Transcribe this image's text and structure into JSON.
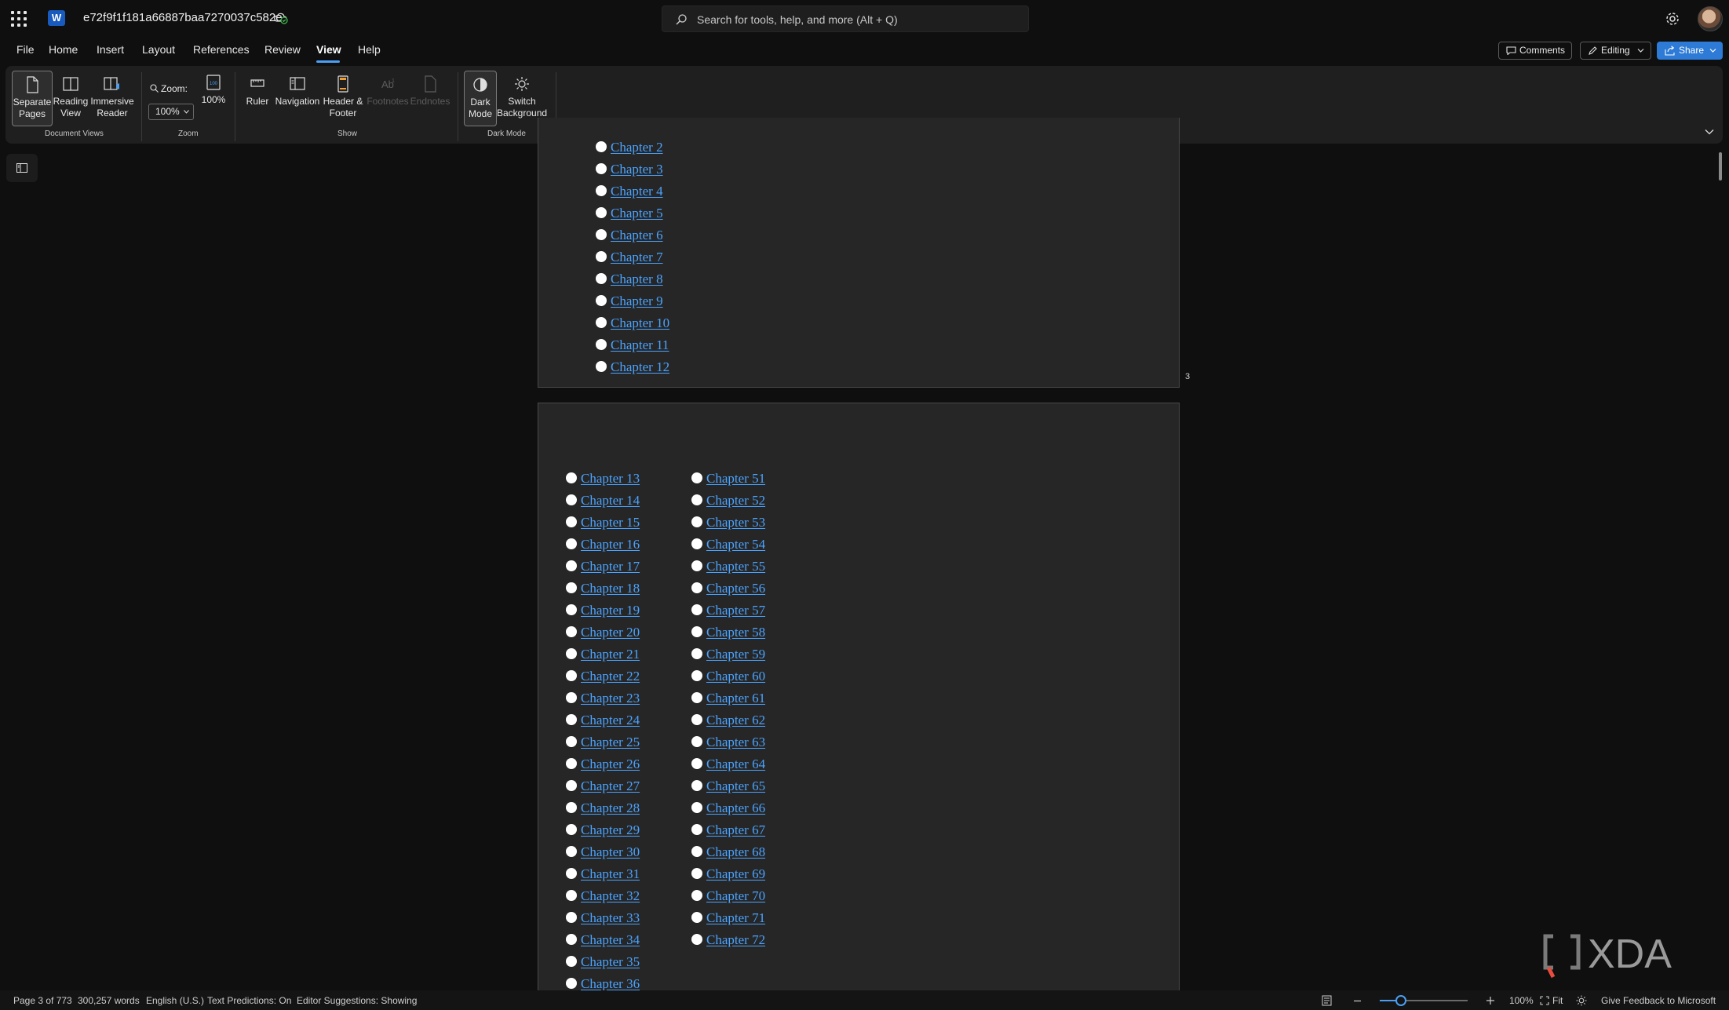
{
  "app": {
    "doc_title": "e72f9f1f181a66887baa7270037c582e",
    "search_placeholder": "Search for tools, help, and more (Alt + Q)"
  },
  "menu": {
    "items": [
      "File",
      "Home",
      "Insert",
      "Layout",
      "References",
      "Review",
      "View",
      "Help"
    ],
    "active": "View",
    "comments_label": "Comments",
    "editing_label": "Editing",
    "share_label": "Share"
  },
  "ribbon": {
    "document_views": {
      "separate_pages": "Separate\nPages",
      "reading_view": "Reading\nView",
      "immersive_reader": "Immersive\nReader",
      "group_label": "Document Views"
    },
    "zoom": {
      "zoom_label": "Zoom:",
      "zoom_value": "100%",
      "hundred_percent": "100%",
      "group_label": "Zoom"
    },
    "show": {
      "ruler": "Ruler",
      "navigation": "Navigation",
      "header_footer": "Header &\nFooter",
      "footnotes": "Footnotes",
      "endnotes": "Endnotes",
      "group_label": "Show"
    },
    "dark_mode": {
      "dark_mode": "Dark\nMode",
      "switch_background": "Switch\nBackground",
      "group_label": "Dark Mode"
    }
  },
  "document": {
    "page1_chapters": [
      "Chapter 2",
      "Chapter 3",
      "Chapter 4",
      "Chapter 5",
      "Chapter 6",
      "Chapter 7",
      "Chapter 8",
      "Chapter 9",
      "Chapter 10",
      "Chapter 11",
      "Chapter 12"
    ],
    "page1_number": "3",
    "page2_col1": [
      "Chapter 13",
      "Chapter 14",
      "Chapter 15",
      "Chapter 16",
      "Chapter 17",
      "Chapter 18",
      "Chapter 19",
      "Chapter 20",
      "Chapter 21",
      "Chapter 22",
      "Chapter 23",
      "Chapter 24",
      "Chapter 25",
      "Chapter 26",
      "Chapter 27",
      "Chapter 28",
      "Chapter 29",
      "Chapter 30",
      "Chapter 31",
      "Chapter 32",
      "Chapter 33",
      "Chapter 34",
      "Chapter 35",
      "Chapter 36"
    ],
    "page2_col2": [
      "Chapter 51",
      "Chapter 52",
      "Chapter 53",
      "Chapter 54",
      "Chapter 55",
      "Chapter 56",
      "Chapter 57",
      "Chapter 58",
      "Chapter 59",
      "Chapter 60",
      "Chapter 61",
      "Chapter 62",
      "Chapter 63",
      "Chapter 64",
      "Chapter 65",
      "Chapter 66",
      "Chapter 67",
      "Chapter 68",
      "Chapter 69",
      "Chapter 70",
      "Chapter 71",
      "Chapter 72"
    ]
  },
  "status": {
    "page": "Page 3 of 773",
    "words": "300,257 words",
    "language": "English (U.S.)",
    "text_predictions": "Text Predictions: On",
    "editor_suggestions": "Editor Suggestions: Showing",
    "zoom": "100%",
    "fit": "Fit",
    "feedback": "Give Feedback to Microsoft",
    "zoom_level_percent": 100
  },
  "colors": {
    "accent": "#2d7bd6",
    "link": "#4ba3ff",
    "page_bg": "#262626",
    "app_bg": "#0f0f0f"
  },
  "watermark": "XDA"
}
